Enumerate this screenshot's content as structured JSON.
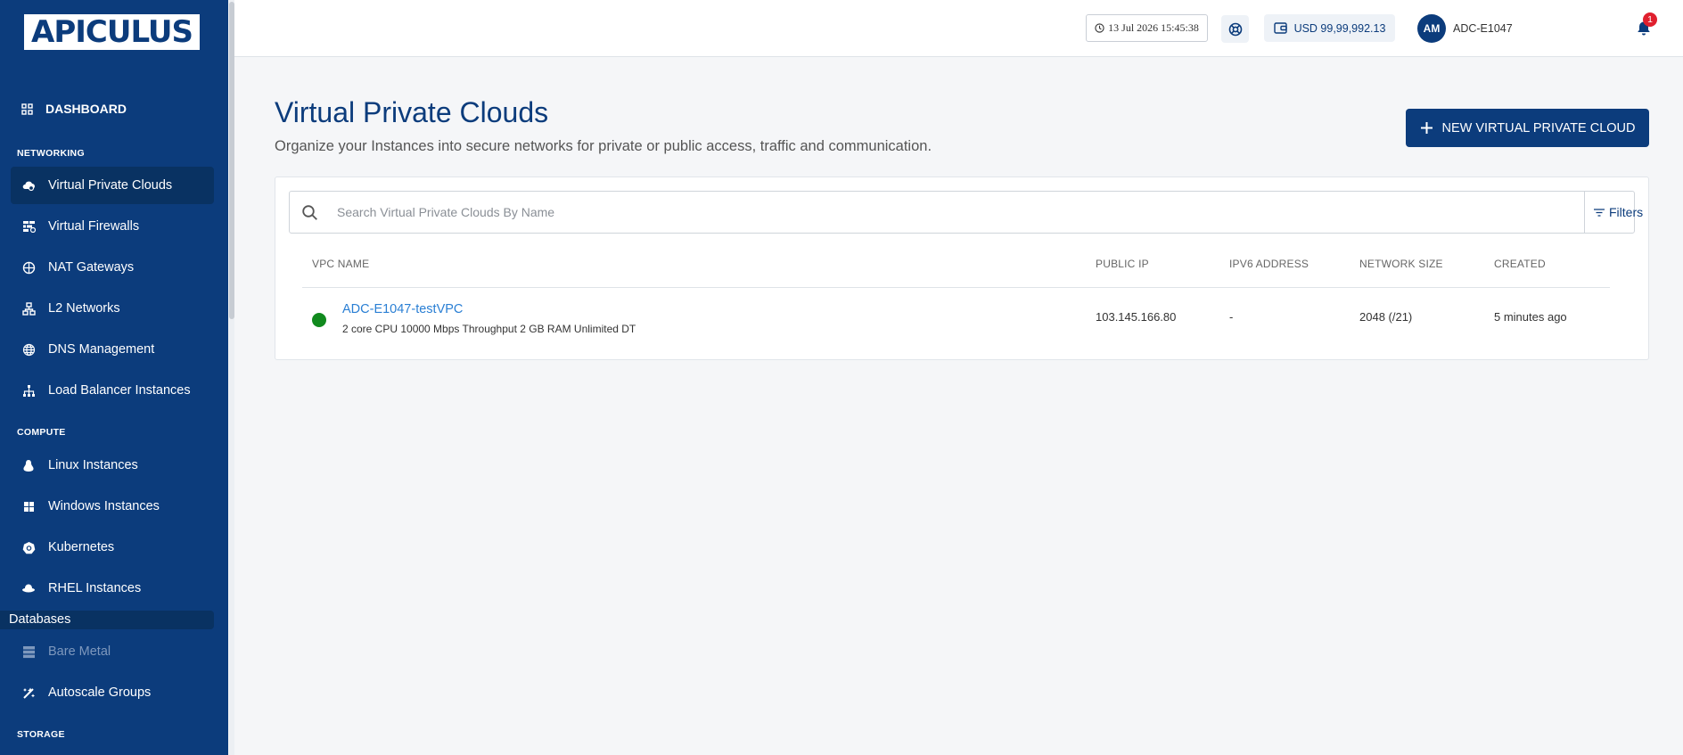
{
  "brand": {
    "logo_text": "APICULUS"
  },
  "sidebar": {
    "dashboard": "DASHBOARD",
    "networking_header": "NETWORKING",
    "networking": [
      {
        "label": "Virtual Private Clouds",
        "icon": "cloud-icon"
      },
      {
        "label": "Virtual Firewalls",
        "icon": "firewall-icon"
      },
      {
        "label": "NAT Gateways",
        "icon": "nat-gateway-icon"
      },
      {
        "label": "L2 Networks",
        "icon": "network-icon"
      },
      {
        "label": "DNS Management",
        "icon": "globe-icon"
      },
      {
        "label": "Load Balancer Instances",
        "icon": "load-balancer-icon"
      }
    ],
    "compute_header": "COMPUTE",
    "compute": [
      {
        "label": "Linux Instances",
        "icon": "linux-icon"
      },
      {
        "label": "Windows Instances",
        "icon": "windows-icon"
      },
      {
        "label": "Kubernetes",
        "icon": "kubernetes-icon"
      },
      {
        "label": "RHEL Instances",
        "icon": "redhat-icon"
      }
    ],
    "databases_label": "Databases",
    "bare_metal": "Bare Metal",
    "autoscale": "Autoscale Groups",
    "storage_header": "STORAGE"
  },
  "topbar": {
    "datetime": "13 Jul 2026 15:45:38",
    "wallet": "USD 99,99,992.13",
    "avatar_initials": "AM",
    "account": "ADC-E1047",
    "notification_count": "1"
  },
  "page": {
    "title": "Virtual Private Clouds",
    "subtitle": "Organize your Instances into secure networks for private or public access, traffic and communication.",
    "new_button": "NEW VIRTUAL PRIVATE CLOUD"
  },
  "search": {
    "placeholder": "Search Virtual Private Clouds By Name",
    "filters_label": "Filters"
  },
  "table": {
    "headers": [
      "VPC NAME",
      "PUBLIC IP",
      "IPV6 ADDRESS",
      "NETWORK SIZE",
      "CREATED"
    ],
    "rows": [
      {
        "name": "ADC-E1047-testVPC",
        "spec": "2 core CPU 10000 Mbps Throughput 2 GB RAM Unlimited DT",
        "public_ip": "103.145.166.80",
        "ipv6": "-",
        "network_size": "2048 (/21)",
        "created": "5 minutes ago",
        "status_color": "#118a1e"
      }
    ]
  },
  "colors": {
    "primary": "#0c3c7c",
    "link": "#2a7fd4",
    "danger": "#e0202e"
  }
}
